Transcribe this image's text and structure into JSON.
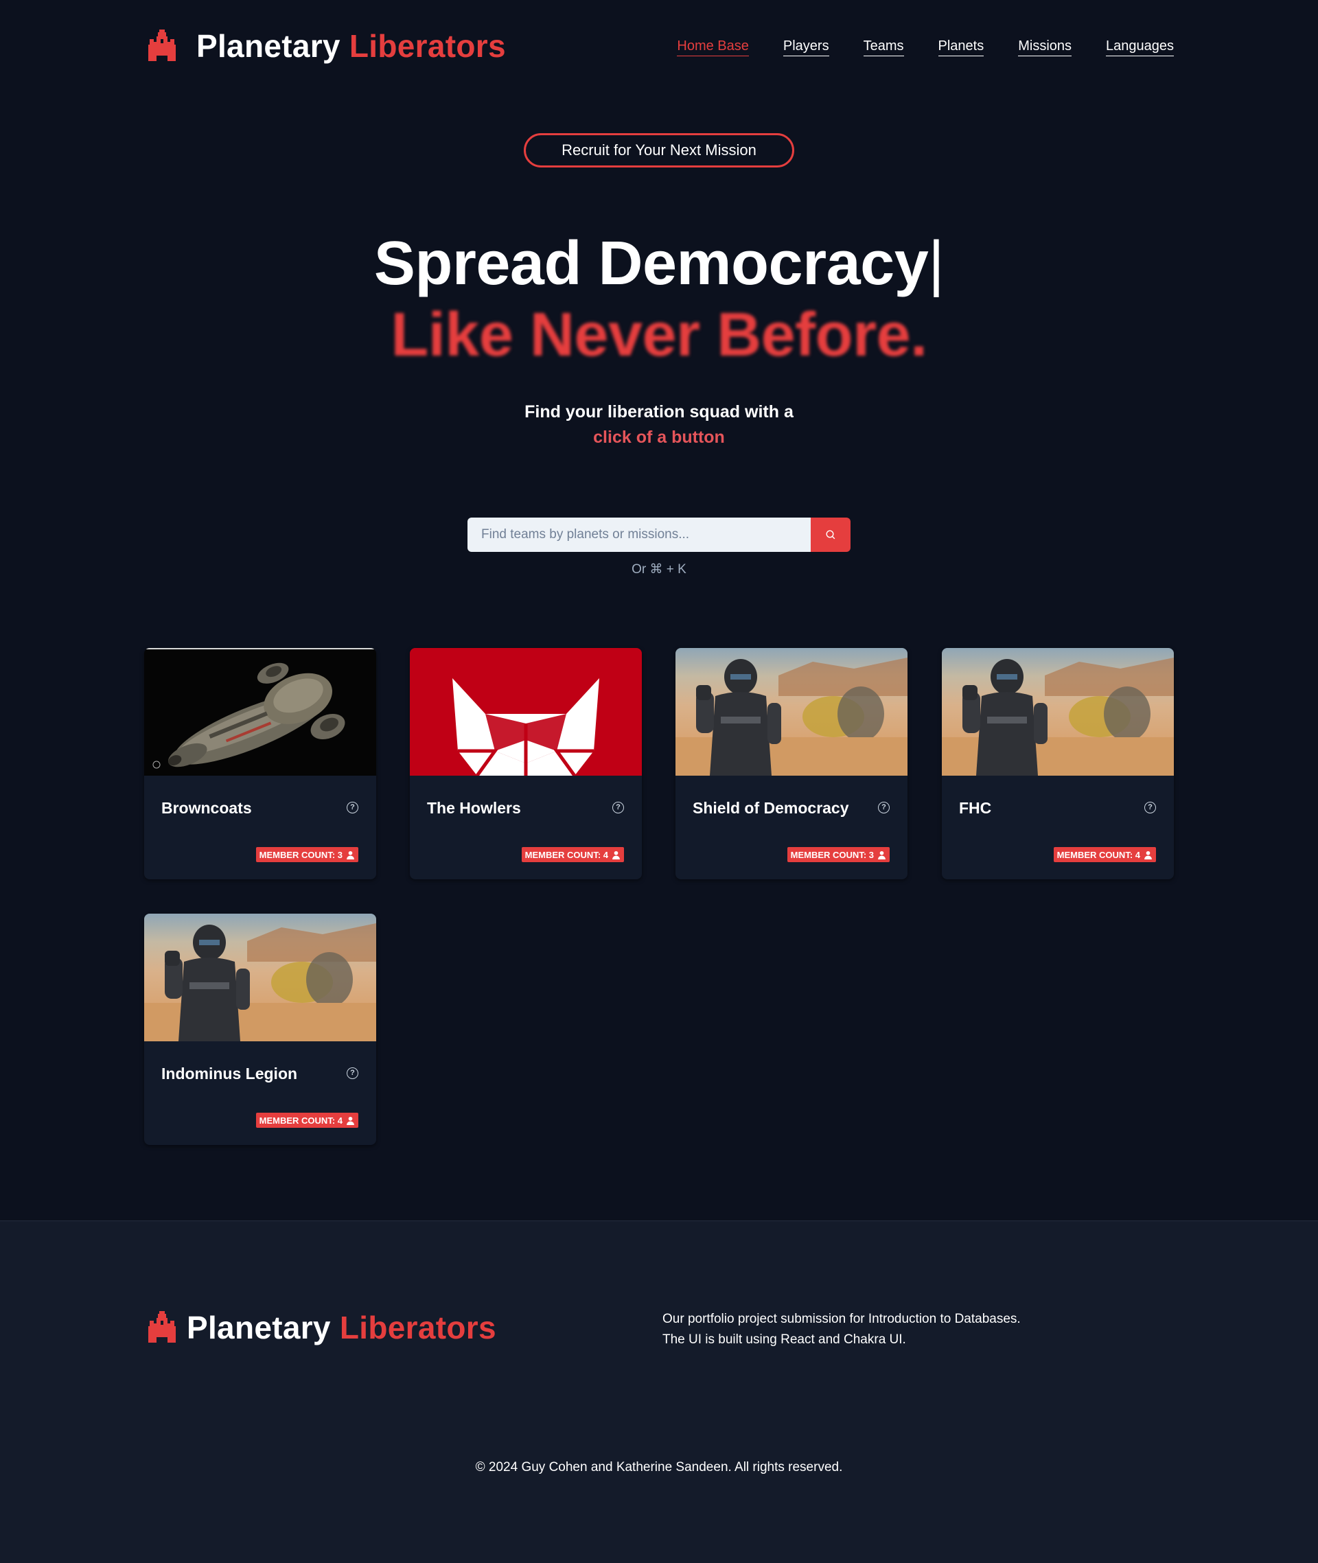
{
  "brand": {
    "name_part1": "Planetary",
    "name_part2": "Liberators",
    "accent_color": "#e53e3e"
  },
  "nav": {
    "items": [
      {
        "label": "Home Base",
        "active": true
      },
      {
        "label": "Players"
      },
      {
        "label": "Teams"
      },
      {
        "label": "Planets"
      },
      {
        "label": "Missions"
      },
      {
        "label": "Languages"
      }
    ]
  },
  "hero": {
    "recruit_label": "Recruit for Your Next Mission",
    "title": "Spread Democracy",
    "cursor": "|",
    "subtitle": "Like Never Before.",
    "tagline_line1": "Find your liberation squad with a",
    "tagline_line2": "click of a button"
  },
  "search": {
    "placeholder": "Find teams by planets or missions...",
    "shortcut": "Or ⌘ + K"
  },
  "teams": [
    {
      "name": "Browncoats",
      "badge": "MEMBER COUNT: 3",
      "image": "spaceship"
    },
    {
      "name": "The Howlers",
      "badge": "MEMBER COUNT: 4",
      "image": "wolf-emblem"
    },
    {
      "name": "Shield of Democracy",
      "badge": "MEMBER COUNT: 3",
      "image": "helldiver-soldier"
    },
    {
      "name": "FHC",
      "badge": "MEMBER COUNT: 4",
      "image": "helldiver-soldier"
    },
    {
      "name": "Indominus Legion",
      "badge": "MEMBER COUNT: 4",
      "image": "helldiver-soldier"
    }
  ],
  "footer": {
    "desc_line1": "Our portfolio project submission for Introduction to Databases.",
    "desc_line2": "The UI is built using React and Chakra UI.",
    "copyright": "© 2024 Guy Cohen and Katherine Sandeen. All rights reserved."
  }
}
